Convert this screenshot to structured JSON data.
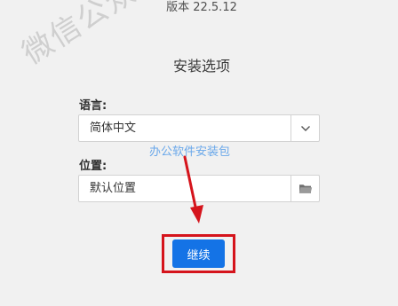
{
  "header": {
    "version_text": "版本 22.5.12"
  },
  "install_options": {
    "title": "安装选项",
    "language": {
      "label": "语言:",
      "selected": "简体中文",
      "dropdown_icon": "chevron-down-icon"
    },
    "location": {
      "label": "位置:",
      "value": "默认位置",
      "browse_icon": "folder-icon"
    },
    "continue_button": "继续"
  },
  "watermarks": {
    "side": "微信公众号",
    "center": "办公软件安装包"
  },
  "colors": {
    "accent": "#1473e6",
    "highlight": "#d5141c",
    "center_watermark": "#6aa8ea"
  }
}
